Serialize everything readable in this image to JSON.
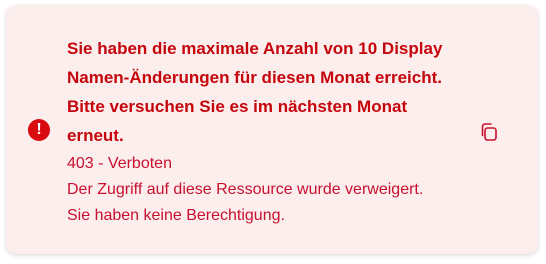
{
  "alert": {
    "title": "Sie haben die maximale Anzahl von 10 Display Namen-Änderungen für diesen Monat erreicht. Bitte versuchen Sie es im nächsten Monat erneut.",
    "status_code": "403 - Verboten",
    "description": "Der Zugriff auf diese Ressource wurde verweigert. Sie haben keine Berechtigung.",
    "icon": "exclamation-circle-icon",
    "icon_glyph": "!",
    "action_icon": "copy-icon",
    "colors": {
      "background": "#fdeeee",
      "accent": "#d90a10",
      "text": "#c8102e"
    }
  }
}
